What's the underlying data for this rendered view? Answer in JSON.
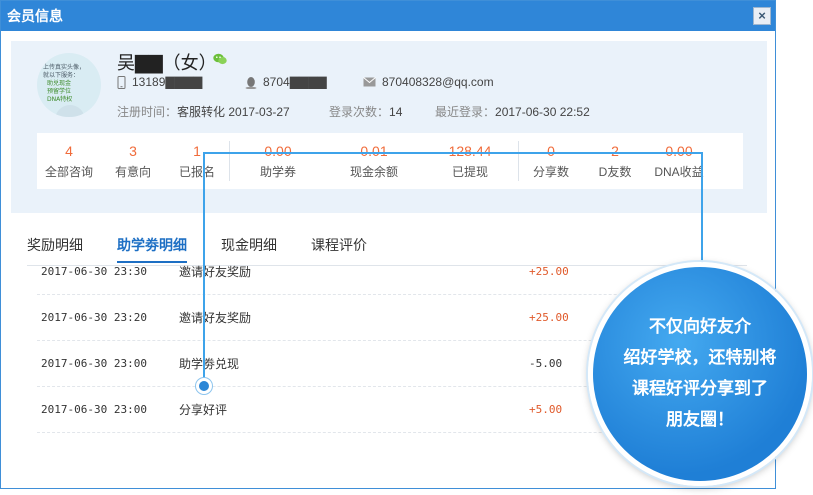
{
  "dialog": {
    "title": "会员信息",
    "close_label": "×"
  },
  "profile": {
    "name": "吴▇▇（女）",
    "phone": "13189▇▇▇▇",
    "qq": "8704▇▇▇▇",
    "email": "870408328@qq.com",
    "register_label": "注册时间：",
    "register_value": "客服转化 2017-03-27",
    "login_count_label": "登录次数：",
    "login_count_value": "14",
    "last_login_label": "最近登录：",
    "last_login_value": "2017-06-30 22:52",
    "avatar_text": [
      "上传真实头像，",
      "就以下服务：",
      "助兑现金",
      "预留学位",
      "DNA特权"
    ]
  },
  "stats": [
    {
      "value": "4",
      "label": "全部咨询"
    },
    {
      "value": "3",
      "label": "有意向"
    },
    {
      "value": "1",
      "label": "已报名"
    },
    {
      "value": "0.00",
      "label": "助学券"
    },
    {
      "value": "0.01",
      "label": "现金余额"
    },
    {
      "value": "128.44",
      "label": "已提现"
    },
    {
      "value": "0",
      "label": "分享数"
    },
    {
      "value": "2",
      "label": "D友数"
    },
    {
      "value": "0.00",
      "label": "DNA收益"
    }
  ],
  "tabs": [
    {
      "label": "奖励明细",
      "active": false
    },
    {
      "label": "助学劵明细",
      "active": true
    },
    {
      "label": "现金明细",
      "active": false
    },
    {
      "label": "课程评价",
      "active": false
    }
  ],
  "rows": [
    {
      "time": "2017-06-30 23:30",
      "desc": "邀请好友奖励",
      "amount": "+25.00"
    },
    {
      "time": "2017-06-30 23:20",
      "desc": "邀请好友奖励",
      "amount": "+25.00"
    },
    {
      "time": "2017-06-30 23:00",
      "desc": "助学劵兑现",
      "amount": "-5.00"
    },
    {
      "time": "2017-06-30 23:00",
      "desc": "分享好评",
      "amount": "+5.00"
    }
  ],
  "callout": {
    "lines": [
      "不仅向好友介",
      "绍好学校，还特别将",
      "课程好评分享到了",
      "朋友圈！"
    ]
  },
  "colors": {
    "accent": "#2f86d8",
    "number": "#f06b3a",
    "bubble": "#1f7fd6"
  }
}
